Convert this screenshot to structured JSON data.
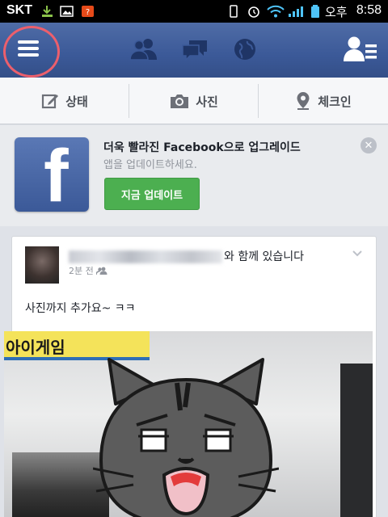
{
  "status_bar": {
    "carrier": "SKT",
    "ampm": "오후",
    "time": "8:58"
  },
  "header": {
    "icons": [
      "menu-icon",
      "friends-icon",
      "messages-icon",
      "globe-icon",
      "friend-requests-icon"
    ]
  },
  "actions": [
    {
      "label": "상태",
      "icon": "edit-icon"
    },
    {
      "label": "사진",
      "icon": "camera-icon"
    },
    {
      "label": "체크인",
      "icon": "location-pin-icon"
    }
  ],
  "promo": {
    "logo_letter": "f",
    "title": "더욱 빨라진 Facebook으로 업그레이드",
    "subtitle": "앱을 업데이트하세요.",
    "button": "지금 업데이트"
  },
  "story": {
    "head_suffix": "와 함께 있습니다",
    "time": "2분 전",
    "text": "사진까지 추가요~ ㅋㅋ",
    "photo_sign": "아이게임"
  },
  "colors": {
    "facebook_blue": "#3b5998",
    "update_green": "#4caf50",
    "highlight_circle": "#ec5f6c"
  }
}
